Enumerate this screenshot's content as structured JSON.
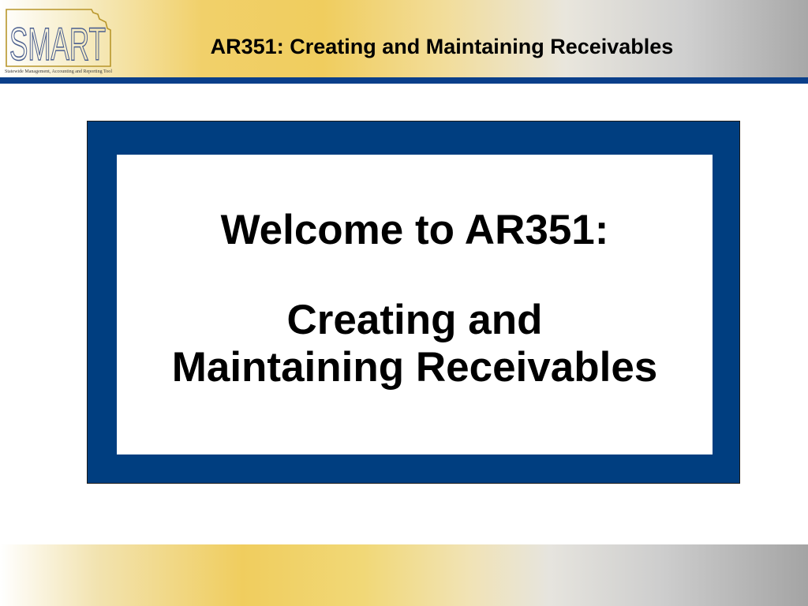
{
  "header": {
    "title": "AR351: Creating and Maintaining Receivables",
    "logo": {
      "wordmark": "SMART",
      "tagline": "Statewide Management, Accounting and Reporting Tool"
    }
  },
  "main": {
    "welcome_line": "Welcome to AR351:",
    "subtitle_line1": "Creating and",
    "subtitle_line2": "Maintaining Receivables"
  },
  "colors": {
    "accent_blue": "#003e80",
    "gold": "#f0cd5e",
    "gray": "#a8a8a8"
  }
}
